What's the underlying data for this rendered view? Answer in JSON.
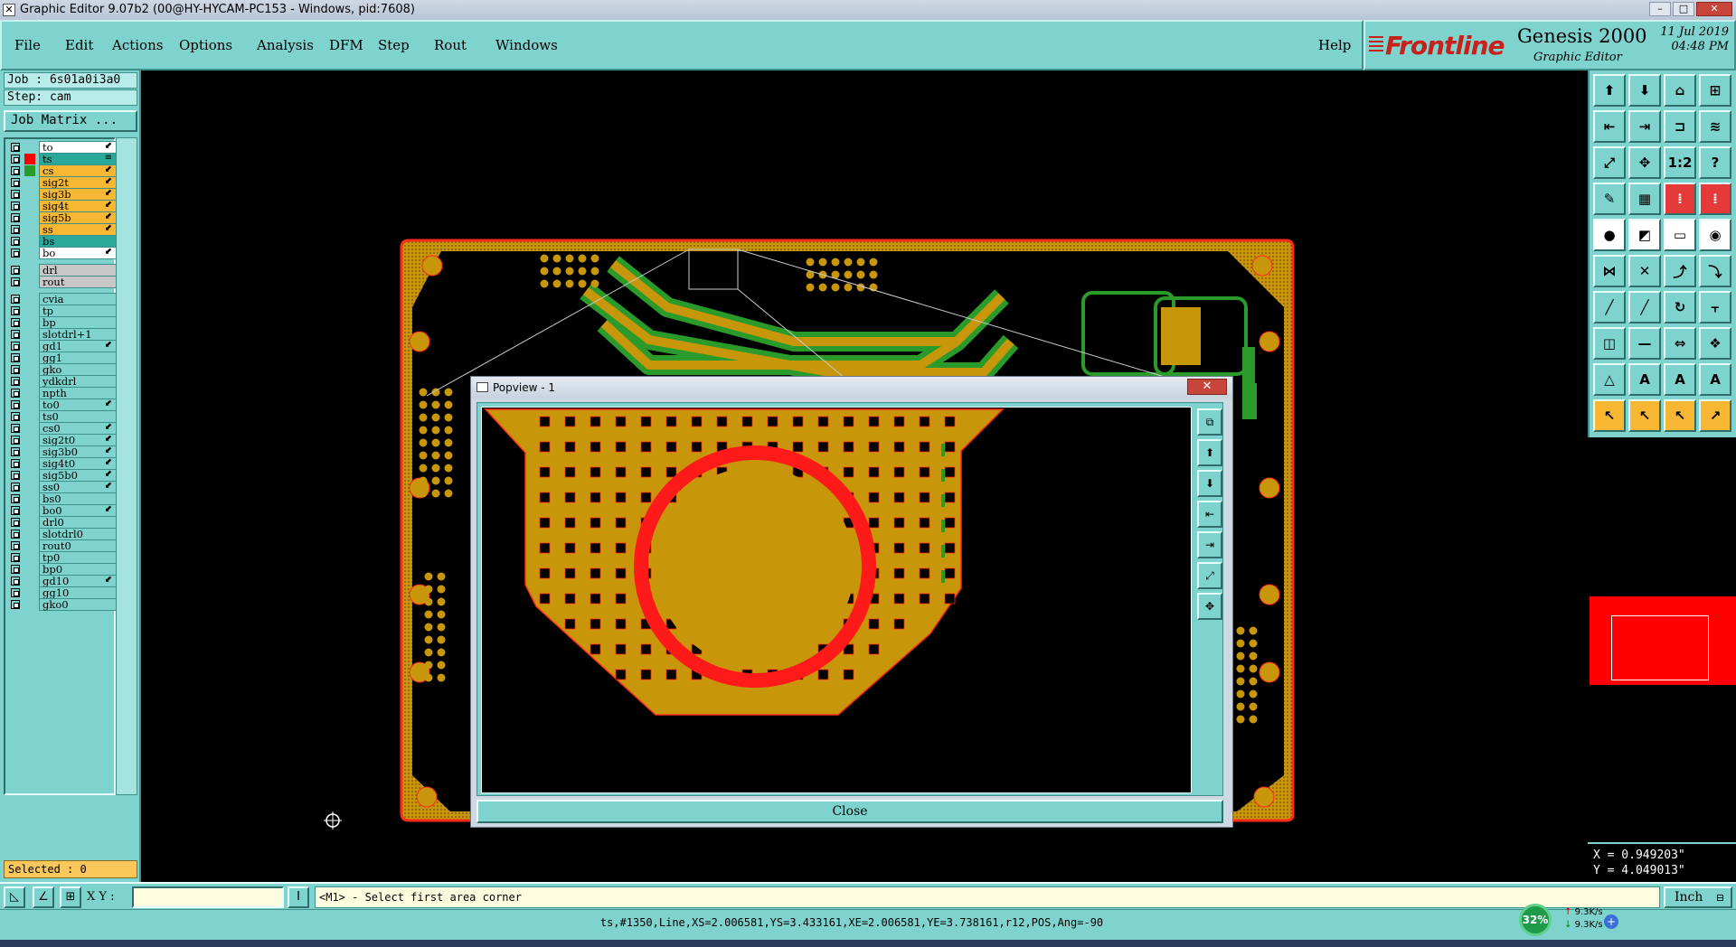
{
  "window": {
    "title": "Graphic Editor 9.07b2 (00@HY-HYCAM-PC153 - Windows, pid:7608)",
    "minimize": "–",
    "maximize": "□",
    "close": "✕"
  },
  "menu": {
    "items": [
      "File",
      "Edit",
      "Actions",
      "Options",
      "Analysis",
      "DFM",
      "Step",
      "Rout",
      "Windows"
    ],
    "help": "Help"
  },
  "brand": {
    "logo": "Frontline",
    "product": "Genesis 2000",
    "subtitle": "Graphic Editor",
    "date": "11 Jul 2019",
    "time": "04:48 PM"
  },
  "job": {
    "job_line": "Job : 6s01a0i3a0",
    "step_line": "Step: cam",
    "job_matrix_label": "Job Matrix ..."
  },
  "layers": [
    {
      "name": "to",
      "color": "#ffffff",
      "swatch": "",
      "mark": "⬋"
    },
    {
      "name": "ts",
      "color": "#2aa89a",
      "swatch": "#ff0000",
      "mark": "≡"
    },
    {
      "name": "cs",
      "color": "#f7b733",
      "swatch": "#2a9a2a",
      "mark": "⬋"
    },
    {
      "name": "sig2t",
      "color": "#f7b733",
      "swatch": "",
      "mark": "⬋"
    },
    {
      "name": "sig3b",
      "color": "#f7b733",
      "swatch": "",
      "mark": "⬋"
    },
    {
      "name": "sig4t",
      "color": "#f7b733",
      "swatch": "",
      "mark": "⬋"
    },
    {
      "name": "sig5b",
      "color": "#f7b733",
      "swatch": "",
      "mark": "⬋"
    },
    {
      "name": "ss",
      "color": "#f7b733",
      "swatch": "",
      "mark": "⬋"
    },
    {
      "name": "bs",
      "color": "#2aa89a",
      "swatch": "",
      "mark": ""
    },
    {
      "name": "bo",
      "color": "#ffffff",
      "swatch": "",
      "mark": "⬋"
    },
    {
      "name": "drl",
      "color": "#c8c8c8",
      "swatch": "",
      "mark": ""
    },
    {
      "name": "rout",
      "color": "#c8c8c8",
      "swatch": "",
      "mark": ""
    },
    {
      "name": "cvia",
      "color": "#7fd3cf",
      "swatch": "",
      "mark": ""
    },
    {
      "name": "tp",
      "color": "#7fd3cf",
      "swatch": "",
      "mark": ""
    },
    {
      "name": "bp",
      "color": "#7fd3cf",
      "swatch": "",
      "mark": ""
    },
    {
      "name": "slotdrl+1",
      "color": "#7fd3cf",
      "swatch": "",
      "mark": ""
    },
    {
      "name": "gd1",
      "color": "#7fd3cf",
      "swatch": "",
      "mark": "⬋"
    },
    {
      "name": "gg1",
      "color": "#7fd3cf",
      "swatch": "",
      "mark": ""
    },
    {
      "name": "gko",
      "color": "#7fd3cf",
      "swatch": "",
      "mark": ""
    },
    {
      "name": "ydkdrl",
      "color": "#7fd3cf",
      "swatch": "",
      "mark": ""
    },
    {
      "name": "npth",
      "color": "#7fd3cf",
      "swatch": "",
      "mark": ""
    },
    {
      "name": "to0",
      "color": "#7fd3cf",
      "swatch": "",
      "mark": "⬋"
    },
    {
      "name": "ts0",
      "color": "#7fd3cf",
      "swatch": "",
      "mark": ""
    },
    {
      "name": "cs0",
      "color": "#7fd3cf",
      "swatch": "",
      "mark": "⬋"
    },
    {
      "name": "sig2t0",
      "color": "#7fd3cf",
      "swatch": "",
      "mark": "⬋"
    },
    {
      "name": "sig3b0",
      "color": "#7fd3cf",
      "swatch": "",
      "mark": "⬋"
    },
    {
      "name": "sig4t0",
      "color": "#7fd3cf",
      "swatch": "",
      "mark": "⬋"
    },
    {
      "name": "sig5b0",
      "color": "#7fd3cf",
      "swatch": "",
      "mark": "⬋"
    },
    {
      "name": "ss0",
      "color": "#7fd3cf",
      "swatch": "",
      "mark": "⬋"
    },
    {
      "name": "bs0",
      "color": "#7fd3cf",
      "swatch": "",
      "mark": ""
    },
    {
      "name": "bo0",
      "color": "#7fd3cf",
      "swatch": "",
      "mark": "⬋"
    },
    {
      "name": "drl0",
      "color": "#7fd3cf",
      "swatch": "",
      "mark": ""
    },
    {
      "name": "slotdrl0",
      "color": "#7fd3cf",
      "swatch": "",
      "mark": ""
    },
    {
      "name": "rout0",
      "color": "#7fd3cf",
      "swatch": "",
      "mark": ""
    },
    {
      "name": "tp0",
      "color": "#7fd3cf",
      "swatch": "",
      "mark": ""
    },
    {
      "name": "bp0",
      "color": "#7fd3cf",
      "swatch": "",
      "mark": ""
    },
    {
      "name": "gd10",
      "color": "#7fd3cf",
      "swatch": "",
      "mark": "⬋"
    },
    {
      "name": "gg10",
      "color": "#7fd3cf",
      "swatch": "",
      "mark": ""
    },
    {
      "name": "gko0",
      "color": "#7fd3cf",
      "swatch": "",
      "mark": ""
    }
  ],
  "selected": "Selected : 0",
  "popview": {
    "title": "Popview - 1",
    "close_label": "Close",
    "title_close": "✕"
  },
  "toolbar": {
    "right_buttons": [
      {
        "icon": "layer-up-icon",
        "glyph": "⬆",
        "style": "teal"
      },
      {
        "icon": "layer-down-icon",
        "glyph": "⬇",
        "style": "teal"
      },
      {
        "icon": "home-icon",
        "glyph": "⌂",
        "style": "teal"
      },
      {
        "icon": "split-view-icon",
        "glyph": "⊞",
        "style": "teal"
      },
      {
        "icon": "pan-left-icon",
        "glyph": "⇤",
        "style": "teal"
      },
      {
        "icon": "pan-right-icon",
        "glyph": "⇥",
        "style": "teal"
      },
      {
        "icon": "mirror-icon",
        "glyph": "⊐",
        "style": "teal"
      },
      {
        "icon": "redraw-icon",
        "glyph": "≋",
        "style": "teal"
      },
      {
        "icon": "zoom-fit-icon",
        "glyph": "⤢",
        "style": "teal"
      },
      {
        "icon": "zoom-home-icon",
        "glyph": "✥",
        "style": "teal"
      },
      {
        "icon": "scale-icon",
        "glyph": "1:2",
        "style": "teal"
      },
      {
        "icon": "help-icon",
        "glyph": "?",
        "style": "teal"
      },
      {
        "icon": "snap-icon",
        "glyph": "✎",
        "style": "teal"
      },
      {
        "icon": "grid-icon",
        "glyph": "▦",
        "style": "teal"
      },
      {
        "icon": "measure-red-icon",
        "glyph": "⁞",
        "style": "red"
      },
      {
        "icon": "measure-red2-icon",
        "glyph": "⁞",
        "style": "red"
      },
      {
        "icon": "pad-icon",
        "glyph": "●",
        "style": "white"
      },
      {
        "icon": "line-icon",
        "glyph": "◩",
        "style": "white"
      },
      {
        "icon": "ruler-icon",
        "glyph": "▭",
        "style": "white"
      },
      {
        "icon": "dot-icon",
        "glyph": "◉",
        "style": "white"
      },
      {
        "icon": "node-icon",
        "glyph": "⋈",
        "style": "teal"
      },
      {
        "icon": "delete-node-icon",
        "glyph": "✕",
        "style": "teal"
      },
      {
        "icon": "connect-icon",
        "glyph": "⤴",
        "style": "teal"
      },
      {
        "icon": "connect2-icon",
        "glyph": "⤵",
        "style": "teal"
      },
      {
        "icon": "draw-line-icon",
        "glyph": "╱",
        "style": "teal"
      },
      {
        "icon": "draw-line2-icon",
        "glyph": "╱",
        "style": "teal"
      },
      {
        "icon": "arc-icon",
        "glyph": "↻",
        "style": "teal"
      },
      {
        "icon": "align-icon",
        "glyph": "⫟",
        "style": "teal"
      },
      {
        "icon": "pad-add-icon",
        "glyph": "◫",
        "style": "teal"
      },
      {
        "icon": "minus-icon",
        "glyph": "—",
        "style": "teal"
      },
      {
        "icon": "resize-icon",
        "glyph": "⇔",
        "style": "teal"
      },
      {
        "icon": "pattern-icon",
        "glyph": "❖",
        "style": "teal"
      },
      {
        "icon": "triangle-icon",
        "glyph": "△",
        "style": "teal"
      },
      {
        "icon": "triangle2-icon",
        "glyph": "A",
        "style": "teal"
      },
      {
        "icon": "triangle3-icon",
        "glyph": "A",
        "style": "teal"
      },
      {
        "icon": "triangle4-icon",
        "glyph": "A",
        "style": "teal"
      },
      {
        "icon": "pointer-icon",
        "glyph": "↖",
        "style": "orange"
      },
      {
        "icon": "pointer2-icon",
        "glyph": "↖",
        "style": "orange"
      },
      {
        "icon": "pointer3-icon",
        "glyph": "↖",
        "style": "orange"
      },
      {
        "icon": "pointer4-icon",
        "glyph": "↗",
        "style": "orange"
      }
    ],
    "popview_tools": [
      {
        "icon": "popview-fit-icon",
        "glyph": "⧉"
      },
      {
        "icon": "popview-up-icon",
        "glyph": "⬆"
      },
      {
        "icon": "popview-down-icon",
        "glyph": "⬇"
      },
      {
        "icon": "popview-left-icon",
        "glyph": "⇤"
      },
      {
        "icon": "popview-right-icon",
        "glyph": "⇥"
      },
      {
        "icon": "popview-zoom-icon",
        "glyph": "⤢"
      },
      {
        "icon": "popview-center-icon",
        "glyph": "✥"
      }
    ]
  },
  "coords": {
    "x": "X = 0.949203\"",
    "y": "Y = 4.049013\""
  },
  "command": {
    "xy_label": "X Y :",
    "xy_value": "",
    "prompt": "<M1> - Select first area corner",
    "units": "Inch"
  },
  "status": {
    "text": "ts,#1350,Line,XS=2.006581,YS=3.433161,XE=2.006581,YE=3.738161,r12,POS,Ang=-90"
  },
  "network": {
    "percent": "32%",
    "up": "9.3K/s",
    "down": "9.3K/s",
    "plus": "+"
  },
  "colors": {
    "panel": "#7fd3cf",
    "copper": "#c7960a",
    "trace_green": "#2a9a2a",
    "soldermask_red": "#ff2a1a"
  }
}
